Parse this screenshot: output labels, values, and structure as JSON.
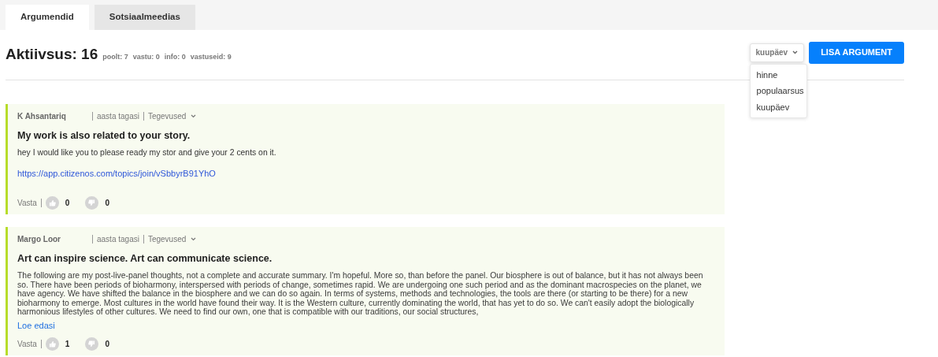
{
  "tabs": [
    {
      "label": "Argumendid",
      "selected": true
    },
    {
      "label": "Sotsiaalmeedias",
      "selected": false
    }
  ],
  "activity": {
    "title": "Aktiivsus: 16",
    "stats": [
      "poolt: 7",
      "vastu: 0",
      "info: 0",
      "vastuseid: 9"
    ]
  },
  "sort": {
    "value": "kuupäev",
    "expanded": true,
    "options": [
      "hinne",
      "populaarsus",
      "kuupäev"
    ]
  },
  "add_button": "LISA ARGUMENT",
  "arguments": [
    {
      "author": "K Ahsantariq",
      "time": "aasta tagasi",
      "actions": "Tegevused",
      "title": "My work is also related to your story.",
      "body": "hey I would like you to please ready my stor and give your 2 cents on it.",
      "link": "https://app.citizenos.com/topics/join/vSbbyrB91YhO",
      "reply": "Vasta",
      "upvotes": "0",
      "downvotes": "0"
    },
    {
      "author": "Margo Loor",
      "time": "aasta tagasi",
      "actions": "Tegevused",
      "title": "Art can inspire science. Art can communicate science.",
      "body": "The following are my post-live-panel thoughts, not a complete and accurate summary. I'm hopeful. More so, than before the panel. Our biosphere is out of balance, but it has not always been so. There have been periods of bioharmony, interspersed with periods of change, sometimes rapid. We are undergoing one such period and as the dominant macrospecies on the planet, we have agency. We have shifted the balance in the biosphere and we can do so again. In terms of systems, methods and technologies, the tools are there (or starting to be there) for a new bioharmony to emerge. Most cultures in the world have found their way. It is the Western culture, currently dominating the world, that has yet to do so. We can't easily adopt the biologically harmonious lifestyles of other cultures. We need to find our own, one that is compatible with our traditions, our social structures,",
      "read_more": "Loe edasi",
      "reply": "Vasta",
      "upvotes": "1",
      "downvotes": "0"
    }
  ]
}
